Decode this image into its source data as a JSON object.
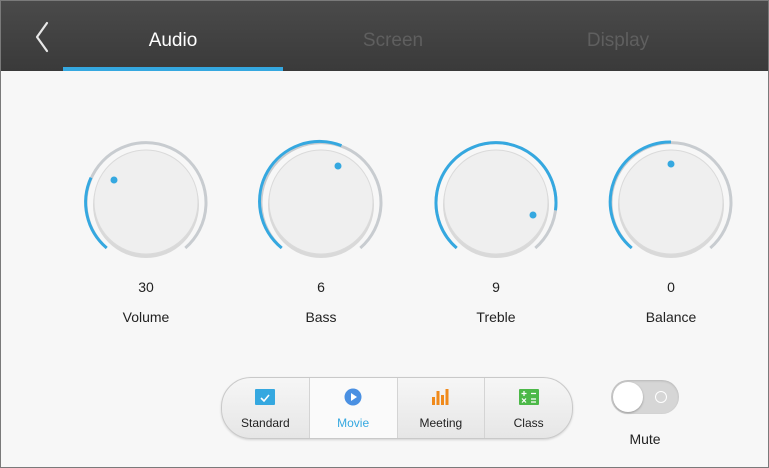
{
  "header": {
    "tabs": [
      {
        "label": "Audio",
        "active": true
      },
      {
        "label": "Screen",
        "active": false
      },
      {
        "label": "Display",
        "active": false
      }
    ]
  },
  "knobs": [
    {
      "label": "Volume",
      "value": "30"
    },
    {
      "label": "Bass",
      "value": "6"
    },
    {
      "label": "Treble",
      "value": "9"
    },
    {
      "label": "Balance",
      "value": "0"
    }
  ],
  "sound_modes": {
    "selected": "Movie",
    "items": [
      {
        "label": "Standard",
        "icon": "standard-icon",
        "color": "#35a8e0"
      },
      {
        "label": "Movie",
        "icon": "play-icon",
        "color": "#4a90e2"
      },
      {
        "label": "Meeting",
        "icon": "bars-icon",
        "color": "#f08a1c"
      },
      {
        "label": "Class",
        "icon": "class-board-icon",
        "color": "#4cb848"
      }
    ]
  },
  "mute": {
    "label": "Mute",
    "state": "off"
  },
  "colors": {
    "accent": "#35a8e0",
    "header_bg": "#3f3f3f"
  }
}
